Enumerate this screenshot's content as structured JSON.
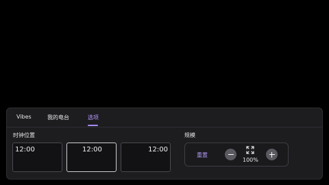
{
  "tabs": [
    {
      "label": "Vibes",
      "active": false
    },
    {
      "label": "我的电台",
      "active": false
    },
    {
      "label": "选项",
      "active": true
    }
  ],
  "clock_position": {
    "label": "时钟位置",
    "options": [
      {
        "time": "12:00",
        "align": "left",
        "selected": false
      },
      {
        "time": "12:00",
        "align": "center",
        "selected": true
      },
      {
        "time": "12:00",
        "align": "right",
        "selected": false
      }
    ]
  },
  "scale": {
    "label": "规模",
    "reset_label": "重置",
    "value": "100%",
    "decrease_icon": "minus-icon",
    "increase_icon": "plus-icon",
    "indicator_icon": "fullscreen-icon"
  },
  "colors": {
    "accent": "#a98cf5",
    "panel": "#1d1d20",
    "background": "#000000"
  }
}
